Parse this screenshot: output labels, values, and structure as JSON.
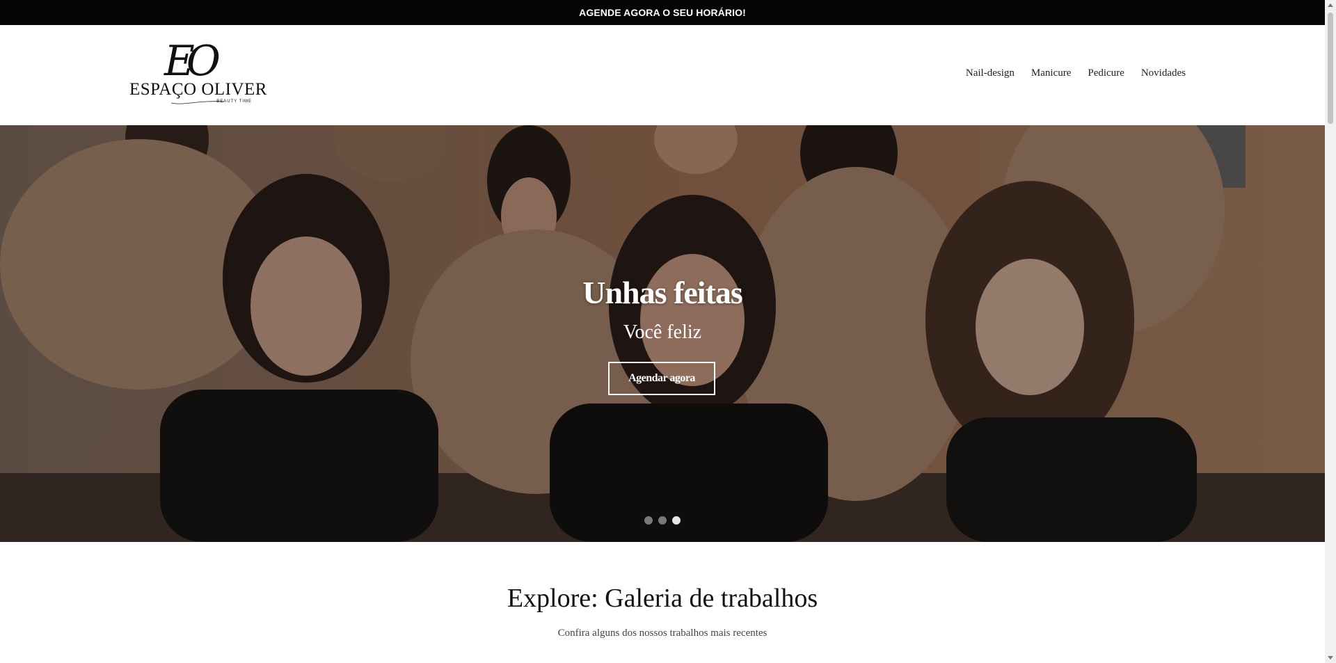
{
  "topbar": {
    "text": "AGENDE AGORA O SEU HORÁRIO!"
  },
  "logo": {
    "monogram": "EO",
    "name": "ESPAÇO OLIVER",
    "tagline": "BEAUTY TIME"
  },
  "nav": {
    "items": [
      {
        "label": "Nail-design"
      },
      {
        "label": "Manicure"
      },
      {
        "label": "Pedicure"
      },
      {
        "label": "Novidades"
      }
    ]
  },
  "hero": {
    "title": "Unhas feitas",
    "subtitle": "Você feliz",
    "button_label": "Agendar agora",
    "slides_total": 3,
    "active_slide": 3
  },
  "gallery": {
    "title": "Explore: Galeria de trabalhos",
    "subtitle": "Confira alguns dos nossos trabalhos mais recentes"
  },
  "colors": {
    "topbar_bg": "#050505",
    "hero_overlay": "#000000",
    "text": "#111111"
  }
}
